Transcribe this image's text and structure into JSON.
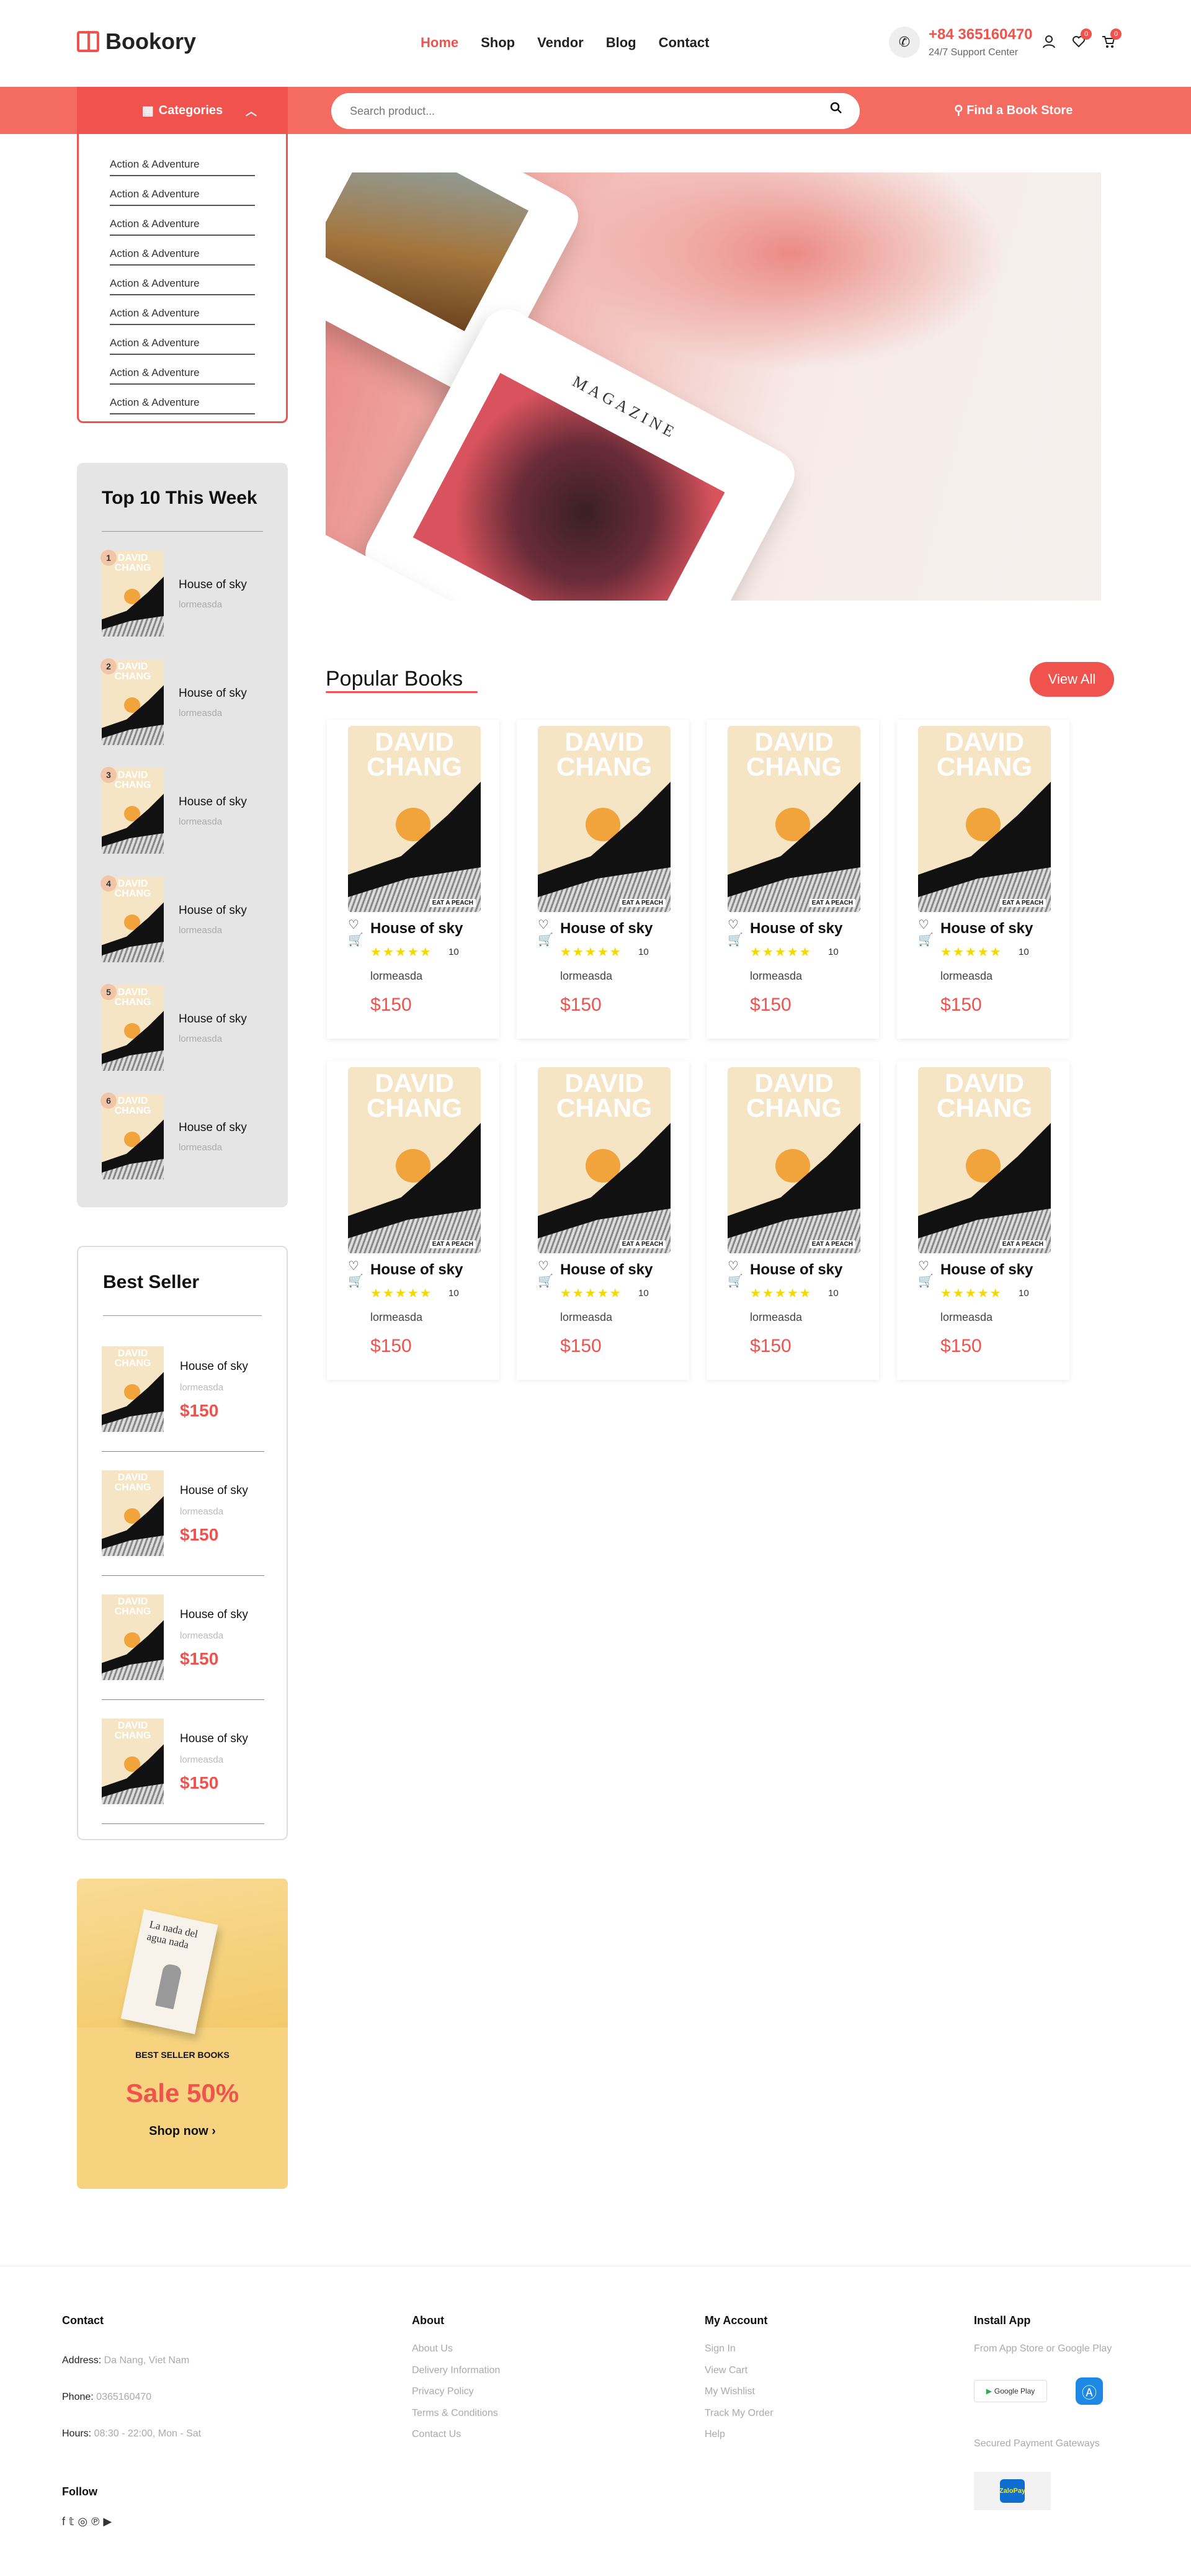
{
  "brand": {
    "name": "Bookory"
  },
  "nav": [
    "Home",
    "Shop",
    "Vendor",
    "Blog",
    "Contact"
  ],
  "support": {
    "phone": "+84 365160470",
    "label": "24/7 Support Center"
  },
  "header_icons": [
    {
      "icon": "user-icon"
    },
    {
      "icon": "heart-icon",
      "badge": "0"
    },
    {
      "icon": "cart-icon",
      "badge": "0"
    }
  ],
  "categories": {
    "label": "Categories",
    "items": [
      "Action & Adventure",
      "Action & Adventure",
      "Action & Adventure",
      "Action & Adventure",
      "Action & Adventure",
      "Action & Adventure",
      "Action & Adventure",
      "Action & Adventure",
      "Action & Adventure"
    ]
  },
  "search": {
    "placeholder": "Search product..."
  },
  "find_store": "Find a Book Store",
  "hero": {
    "magazine_text": "MAGAZINE"
  },
  "popular": {
    "title": "Popular Books",
    "view_all": "View All",
    "cover_title": "DAVID CHANG",
    "cover_label": "EAT A PEACH",
    "books": [
      {
        "name": "House of sky",
        "author": "lormeasda",
        "price": "$150",
        "rating": "10",
        "stars": 5
      },
      {
        "name": "House of sky",
        "author": "lormeasda",
        "price": "$150",
        "rating": "10",
        "stars": 5
      },
      {
        "name": "House of sky",
        "author": "lormeasda",
        "price": "$150",
        "rating": "10",
        "stars": 5
      },
      {
        "name": "House of sky",
        "author": "lormeasda",
        "price": "$150",
        "rating": "10",
        "stars": 5
      },
      {
        "name": "House of sky",
        "author": "lormeasda",
        "price": "$150",
        "rating": "10",
        "stars": 5
      },
      {
        "name": "House of sky",
        "author": "lormeasda",
        "price": "$150",
        "rating": "10",
        "stars": 5
      },
      {
        "name": "House of sky",
        "author": "lormeasda",
        "price": "$150",
        "rating": "10",
        "stars": 5
      },
      {
        "name": "House of sky",
        "author": "lormeasda",
        "price": "$150",
        "rating": "10",
        "stars": 5
      }
    ]
  },
  "top10": {
    "title": "Top 10 This Week",
    "items": [
      {
        "rank": "1",
        "name": "House of sky",
        "author": "lormeasda"
      },
      {
        "rank": "2",
        "name": "House of sky",
        "author": "lormeasda"
      },
      {
        "rank": "3",
        "name": "House of sky",
        "author": "lormeasda"
      },
      {
        "rank": "4",
        "name": "House of sky",
        "author": "lormeasda"
      },
      {
        "rank": "5",
        "name": "House of sky",
        "author": "lormeasda"
      },
      {
        "rank": "6",
        "name": "House of sky",
        "author": "lormeasda"
      }
    ]
  },
  "best_seller": {
    "title": "Best Seller",
    "items": [
      {
        "name": "House of sky",
        "author": "lormeasda",
        "price": "$150"
      },
      {
        "name": "House of sky",
        "author": "lormeasda",
        "price": "$150"
      },
      {
        "name": "House of sky",
        "author": "lormeasda",
        "price": "$150"
      },
      {
        "name": "House of sky",
        "author": "lormeasda",
        "price": "$150"
      }
    ]
  },
  "promo": {
    "book_title": "La nada del agua nada",
    "tag": "BEST SELLER BOOKS",
    "sale": "Sale 50%",
    "cta": "Shop now"
  },
  "footer": {
    "contact": {
      "title": "Contact",
      "address_label": "Address:",
      "address": "Da Nang, Viet Nam",
      "phone_label": "Phone:",
      "phone": "0365160470",
      "hours_label": "Hours:",
      "hours": "08:30 - 22:00, Mon - Sat"
    },
    "follow": "Follow",
    "about": {
      "title": "About",
      "links": [
        "About Us",
        "Delivery Information",
        "Privacy Policy",
        "Terms & Conditions",
        "Contact Us"
      ]
    },
    "account": {
      "title": "My Account",
      "links": [
        "Sign In",
        "View Cart",
        "My Wishlist",
        "Track My Order",
        "Help"
      ]
    },
    "app": {
      "title": "Install App",
      "sub": "From App Store or Google Play",
      "google_play": "Google Play",
      "payment": "Secured Payment Gateways",
      "pay_logo": "ZaloPay"
    }
  },
  "colors": {
    "accent": "#f0524d",
    "bar": "#f46b62",
    "star": "#f5d800",
    "panel": "#e5e5e5",
    "promo": "#f7d37f"
  }
}
